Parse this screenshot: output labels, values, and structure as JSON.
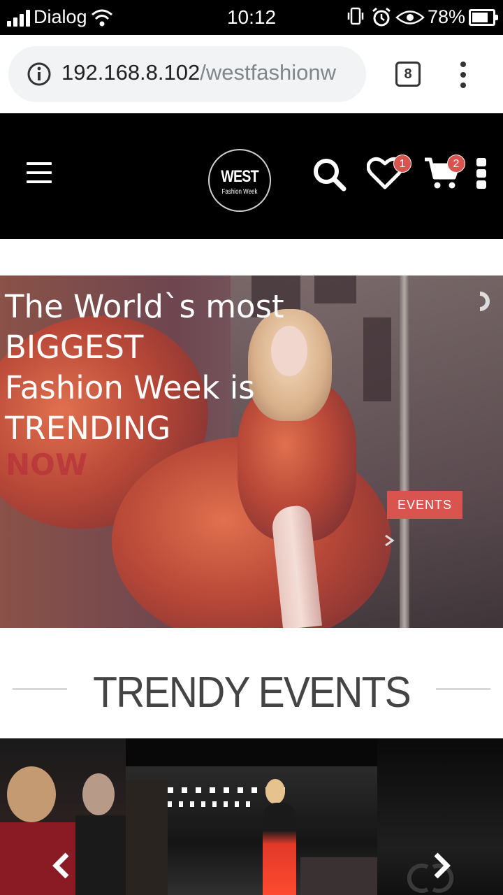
{
  "status_bar": {
    "carrier": "Dialog",
    "time": "10:12",
    "battery_percent": "78%",
    "battery_level": 0.78,
    "icons": [
      "signal-icon",
      "wifi-icon",
      "vibrate-icon",
      "alarm-icon",
      "eye-icon",
      "battery-icon"
    ]
  },
  "browser": {
    "url_host": "192.168.8.102",
    "url_path": "/westfashionw",
    "tab_count": "8",
    "icons": [
      "info-icon",
      "tabs-icon",
      "menu-icon"
    ]
  },
  "header": {
    "logo_main": "WEST",
    "logo_sub": "Fashion Week",
    "wishlist_count": "1",
    "cart_count": "2",
    "icons": [
      "hamburger-icon",
      "search-icon",
      "heart-icon",
      "cart-icon",
      "more-icon"
    ]
  },
  "hero": {
    "title_lines": [
      "The World`s most",
      "BIGGEST",
      "Fashion Week is",
      "TRENDING"
    ],
    "accent_word": "NOW",
    "button_label": "EVENTS",
    "accent_color": "#d9534f"
  },
  "section": {
    "title": "TRENDY EVENTS"
  },
  "carousel": {
    "icons": [
      "chevron-left-icon",
      "chevron-right-icon"
    ]
  }
}
